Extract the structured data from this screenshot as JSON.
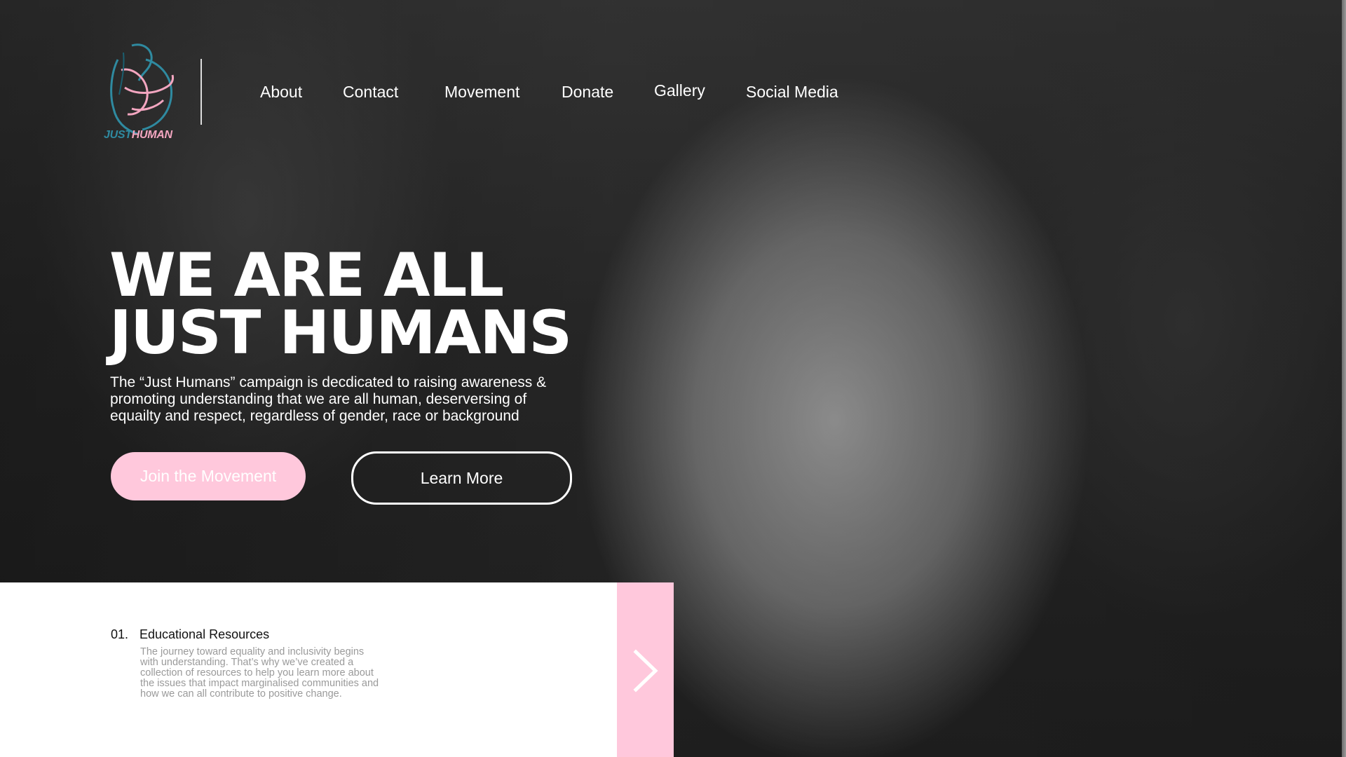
{
  "brand": {
    "logo_text_just": "JUST",
    "logo_text_human": "HUMAN",
    "logo_icon": "embracing-figure-line-art",
    "colors": {
      "teal": "#2f8aa0",
      "pink": "#ffc8dc"
    }
  },
  "nav": {
    "items": [
      {
        "label": "About"
      },
      {
        "label": "Contact"
      },
      {
        "label": "Movement"
      },
      {
        "label": "Donate"
      },
      {
        "label": "Gallery"
      },
      {
        "label": "Social Media"
      }
    ]
  },
  "hero": {
    "title_line1": "WE ARE ALL",
    "title_line2": "JUST HUMANS",
    "description_line1": "The “Just Humans” campaign is decdicated to raising awareness &",
    "description_line2": "promoting understanding that we are all human, deserversing of",
    "description_line3": "equailty and respect, regardless of gender, race or background",
    "join_button": "Join the Movement",
    "learn_button": "Learn More"
  },
  "features": {
    "current": {
      "number": "01.",
      "title": "Educational Resources",
      "body_line1": "The journey toward equality and inclusivity begins",
      "body_line2": "with understanding. That’s why we’ve created a",
      "body_line3": "collection of resources to help you learn more about",
      "body_line4": "the issues that impact marginalised communities and",
      "body_line5": "how we can all contribute to positive change."
    },
    "next_icon": "chevron-right-icon"
  }
}
